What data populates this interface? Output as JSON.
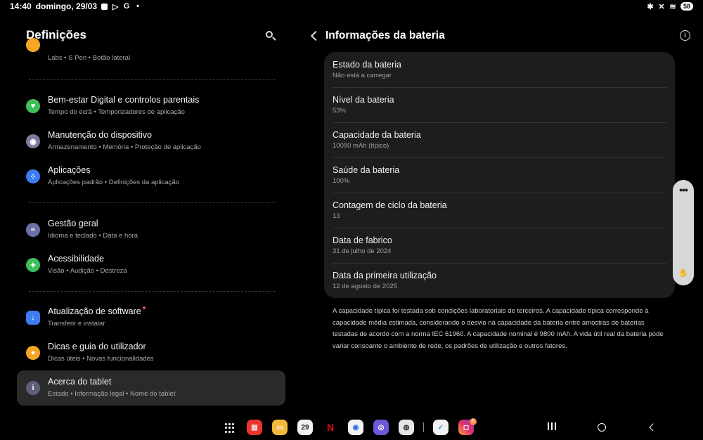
{
  "status_bar": {
    "time": "14:40",
    "date": "domingo, 29/03",
    "battery_level": "58"
  },
  "left_pane": {
    "title": "Definições",
    "partial_item": {
      "subtitle": [
        "Labs",
        "S Pen",
        "Botão lateral"
      ],
      "icon": "yellow-circle-icon",
      "color": "#f5a623"
    },
    "items": [
      {
        "title": "Bem-estar Digital e controlos parentais",
        "subtitle": [
          "Tempo do ecrã",
          "Temporizadores de aplicação"
        ],
        "icon": "wellbeing-icon",
        "color": "#3fbf5a"
      },
      {
        "title": "Manutenção do dispositivo",
        "subtitle": [
          "Armazenamento",
          "Memória",
          "Proteção de aplicação"
        ],
        "icon": "device-care-icon",
        "color": "#7d7a9c"
      },
      {
        "title": "Aplicações",
        "subtitle": [
          "Aplicações padrão",
          "Definições da aplicação"
        ],
        "icon": "apps-icon",
        "color": "#3d7bf0"
      },
      {
        "title": "Gestão geral",
        "subtitle": [
          "Idioma e teclado",
          "Data e hora"
        ],
        "icon": "general-management-icon",
        "color": "#6a6fa6"
      },
      {
        "title": "Acessibilidade",
        "subtitle": [
          "Visão",
          "Audição",
          "Destreza"
        ],
        "icon": "accessibility-icon",
        "color": "#3fbf5a"
      },
      {
        "title": "Atualização de software",
        "subtitle": [
          "Transferir e instalar"
        ],
        "icon": "software-update-icon",
        "color": "#3d7bf0"
      },
      {
        "title": "Dicas e guia do utilizador",
        "subtitle": [
          "Dicas úteis",
          "Novas funcionalidades"
        ],
        "icon": "tips-icon",
        "color": "#f5a623"
      },
      {
        "title": "Acerca do tablet",
        "subtitle": [
          "Estado",
          "Informação legal",
          "Nome do tablet"
        ],
        "icon": "about-icon",
        "color": "#5d5f7a"
      }
    ]
  },
  "right_pane": {
    "title": "Informações da bateria",
    "rows": [
      {
        "label": "Estado da bateria",
        "value": "Não está a carregar"
      },
      {
        "label": "Nível da bateria",
        "value": "53%"
      },
      {
        "label": "Capacidade da bateria",
        "value": "10090 mAh (típico)"
      },
      {
        "label": "Saúde da bateria",
        "value": "100%"
      },
      {
        "label": "Contagem de ciclo da bateria",
        "value": "13"
      },
      {
        "label": "Data de fabrico",
        "value": "31 de julho de 2024"
      },
      {
        "label": "Data da primeira utilização",
        "value": "12 de agosto de 2025"
      }
    ],
    "footnote": "A capacidade típica foi testada sob condições laboratoriais de terceiros. A capacidade típica corresponde à capacidade média estimada, considerando o desvio na capacidade da bateria entre amostras de baterias testadas de acordo com a norma IEC 61960. A capacidade nominal é 9800 mAh. A vida útil real da bateria pode variar consoante o ambiente de rede, os padrões de utilização e outros fatores."
  },
  "taskbar": {
    "calendar_day": "29",
    "instagram_badge": "6",
    "apps": [
      "app-drawer-icon",
      "samsung-notes-icon",
      "my-files-icon",
      "calendar-icon",
      "netflix-icon",
      "messages-icon",
      "internet-icon",
      "camera-icon",
      "reminder-icon",
      "instagram-icon"
    ]
  }
}
